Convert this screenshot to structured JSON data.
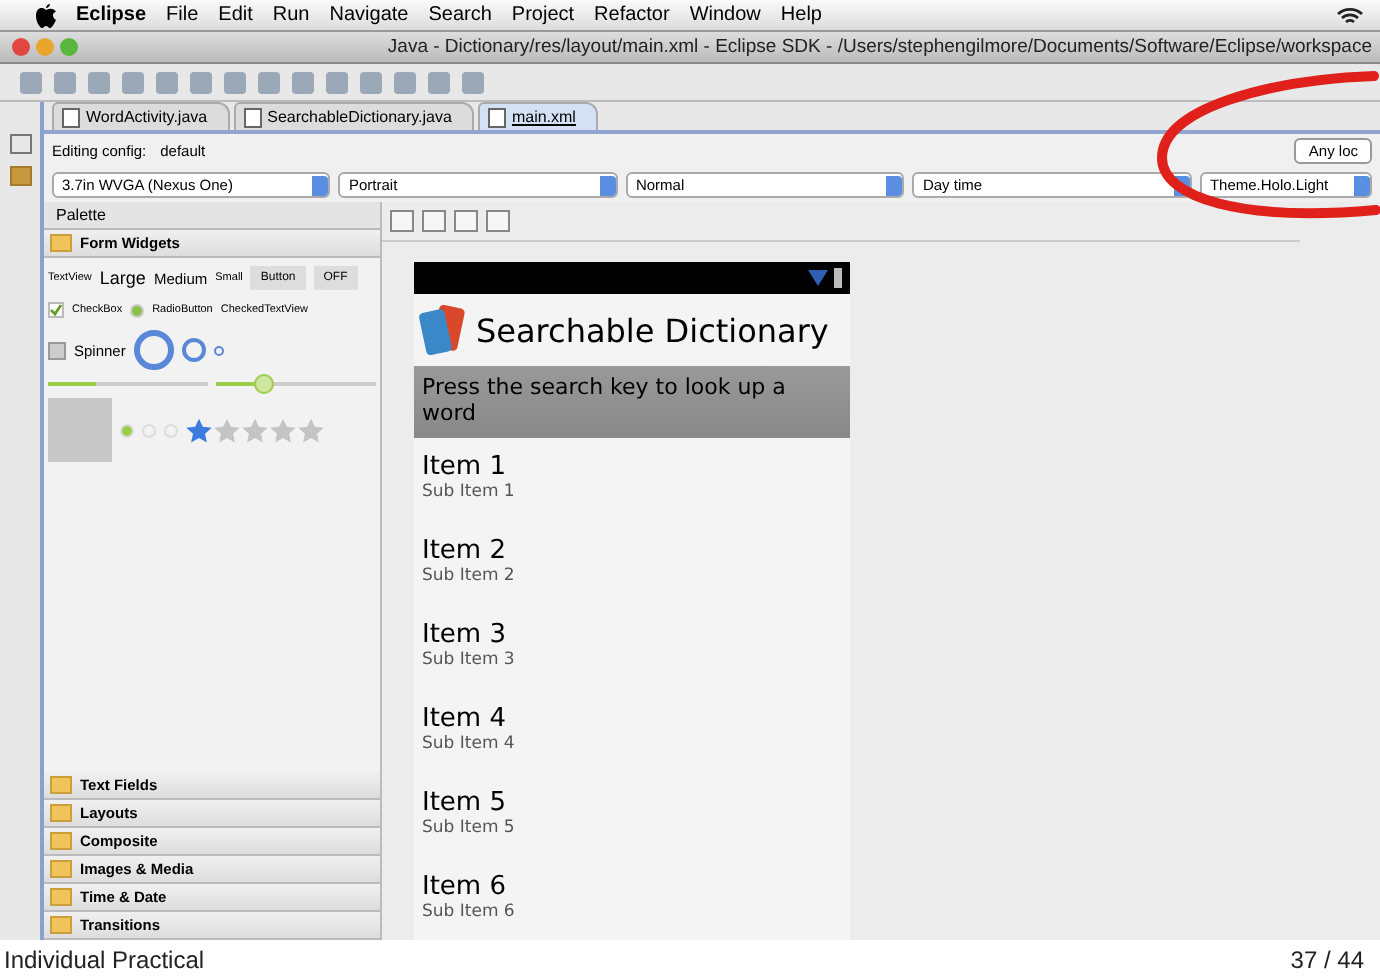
{
  "menubar": {
    "app": "Eclipse",
    "items": [
      "File",
      "Edit",
      "Run",
      "Navigate",
      "Search",
      "Project",
      "Refactor",
      "Window",
      "Help"
    ]
  },
  "window": {
    "title": "Java - Dictionary/res/layout/main.xml - Eclipse SDK - /Users/stephengilmore/Documents/Software/Eclipse/workspace"
  },
  "editor_tabs": [
    {
      "label": "WordActivity.java",
      "selected": false
    },
    {
      "label": "SearchableDictionary.java",
      "selected": false
    },
    {
      "label": "main.xml",
      "selected": true
    }
  ],
  "config": {
    "label": "Editing config:",
    "value": "default",
    "locale_button": "Any loc",
    "dropdowns": [
      "3.7in WVGA (Nexus One)",
      "Portrait",
      "Normal",
      "Day time",
      "Theme.Holo.Light"
    ]
  },
  "palette": {
    "title": "Palette",
    "open_section": "Form Widgets",
    "text_samples": [
      "TextView",
      "Large",
      "Medium",
      "Small"
    ],
    "button": "Button",
    "toggle": "OFF",
    "checkbox": {
      "label": "CheckBox",
      "checked": true
    },
    "radio": {
      "label": "RadioButton",
      "selected": true
    },
    "checked_text": "CheckedTextView",
    "spinner": "Spinner",
    "progress": {
      "level": 0.3
    },
    "seek": {
      "level": 0.3
    },
    "rating": {
      "stars": 1
    },
    "sections": [
      "Text Fields",
      "Layouts",
      "Composite",
      "Images & Media",
      "Time & Date",
      "Transitions"
    ]
  },
  "device": {
    "app_title": "Searchable Dictionary",
    "hint": "Press the search key to look up a word",
    "items": [
      {
        "title": "Item 1",
        "subtitle": "Sub Item 1"
      },
      {
        "title": "Item 2",
        "subtitle": "Sub Item 2"
      },
      {
        "title": "Item 3",
        "subtitle": "Sub Item 3"
      },
      {
        "title": "Item 4",
        "subtitle": "Sub Item 4"
      },
      {
        "title": "Item 5",
        "subtitle": "Sub Item 5"
      },
      {
        "title": "Item 6",
        "subtitle": "Sub Item 6"
      }
    ]
  },
  "footer": {
    "title": "Individual Practical",
    "page": "37 / 44"
  }
}
